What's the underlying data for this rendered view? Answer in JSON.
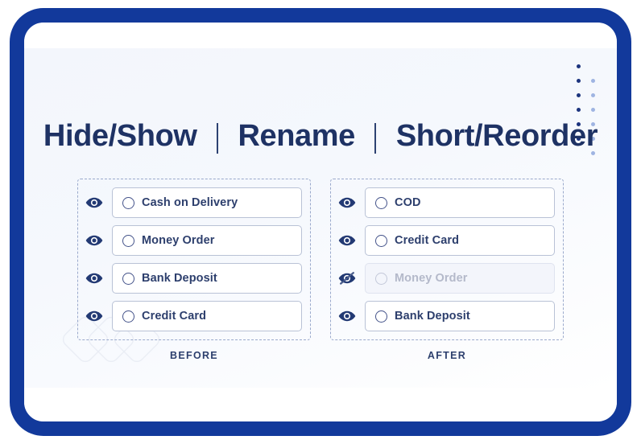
{
  "title": {
    "segments": [
      "Hide/Show",
      "Rename",
      "Short/Reorder"
    ],
    "separator": "|",
    "color": "#1e3264"
  },
  "colors": {
    "frame_blue": "#12399b",
    "navy_text": "#1e3264",
    "field_border": "#b9c2d6",
    "dashed_border": "#9aa9cc",
    "disabled_bg": "#f3f5fb",
    "disabled_text": "#b4b9ca",
    "dot_dark": "#1c347e",
    "dot_light": "#9fb4e2"
  },
  "panels": [
    {
      "side": "before",
      "caption": "BEFORE",
      "rows": [
        {
          "label": "Cash on Delivery",
          "visible": true,
          "eye_icon": "eye-icon"
        },
        {
          "label": "Money Order",
          "visible": true,
          "eye_icon": "eye-icon"
        },
        {
          "label": "Bank Deposit",
          "visible": true,
          "eye_icon": "eye-icon"
        },
        {
          "label": "Credit Card",
          "visible": true,
          "eye_icon": "eye-icon"
        }
      ]
    },
    {
      "side": "after",
      "caption": "AFTER",
      "rows": [
        {
          "label": "COD",
          "visible": true,
          "eye_icon": "eye-icon"
        },
        {
          "label": "Credit Card",
          "visible": true,
          "eye_icon": "eye-icon"
        },
        {
          "label": "Money Order",
          "visible": false,
          "eye_icon": "eye-off-icon"
        },
        {
          "label": "Bank Deposit",
          "visible": true,
          "eye_icon": "eye-icon"
        }
      ]
    }
  ],
  "decor": {
    "dots_dark_count": 6,
    "dots_light_count": 6,
    "watermark": "overlapping-diamonds-logo"
  }
}
